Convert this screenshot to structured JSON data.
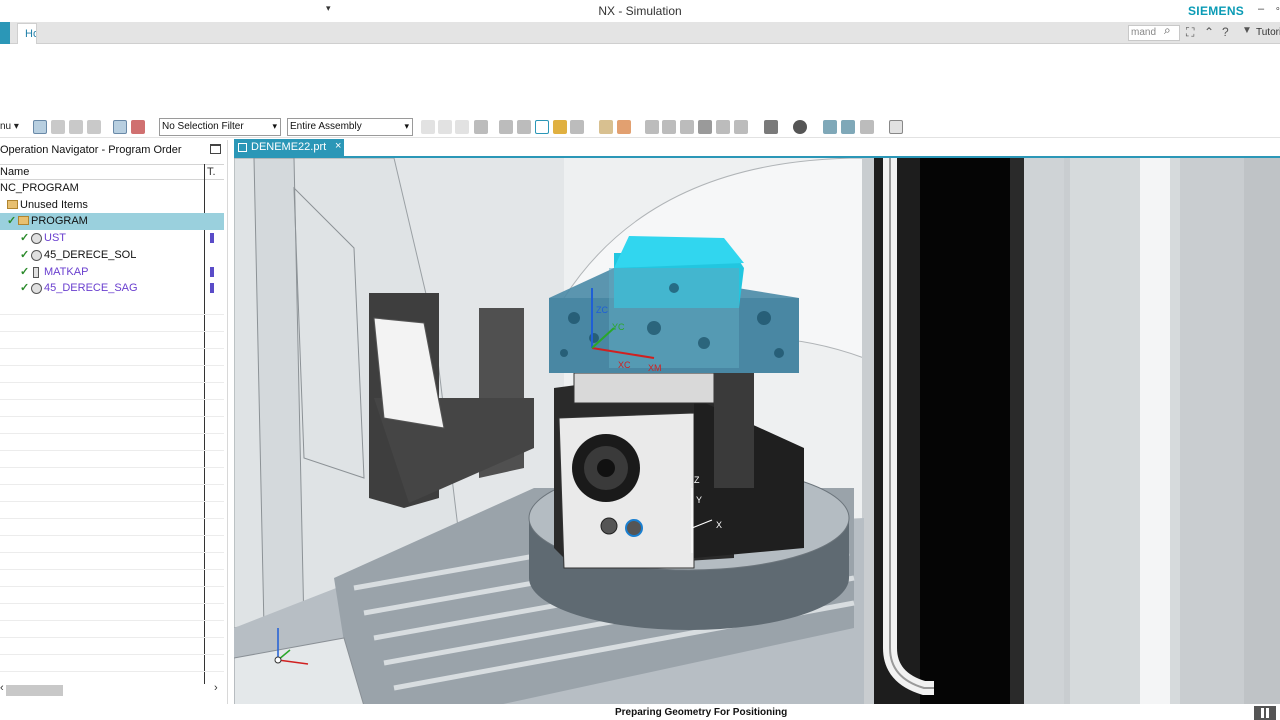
{
  "window": {
    "title": "NX - Simulation",
    "brand": "SIEMENS",
    "quick_access_arrow": "▾",
    "minimize": "–",
    "extra": "∘"
  },
  "ribbon": {
    "home_tab": "Home",
    "command_search_placeholder": "mand",
    "tutorials": "Tutorials"
  },
  "selection_bar": {
    "menu_label": "nu ▾",
    "type_filter": "No Selection Filter",
    "scope": "Entire Assembly"
  },
  "navigator": {
    "title": "Operation Navigator - Program Order",
    "col_name": "Name",
    "col_tool": "T.",
    "root": "NC_PROGRAM",
    "unused": "Unused Items",
    "program": "PROGRAM",
    "operations": [
      "UST",
      "45_DERECE_SOL",
      "MATKAP",
      "45_DERECE_SAG"
    ]
  },
  "document": {
    "tab_label": "DENEME22.prt",
    "close": "×"
  },
  "viewport": {
    "labels": {
      "zc": "ZC",
      "yc": "YC",
      "xc": "XC",
      "xm": "XM",
      "z": "Z",
      "y": "Y",
      "x": "X"
    }
  },
  "status": {
    "message": "Preparing Geometry For Positioning"
  },
  "colors": {
    "accent": "#2b97b7",
    "selection": "#9ad0dd",
    "brand": "#0a9bb5",
    "check": "#2a8a2a",
    "op_text": "#6a3fcf"
  }
}
